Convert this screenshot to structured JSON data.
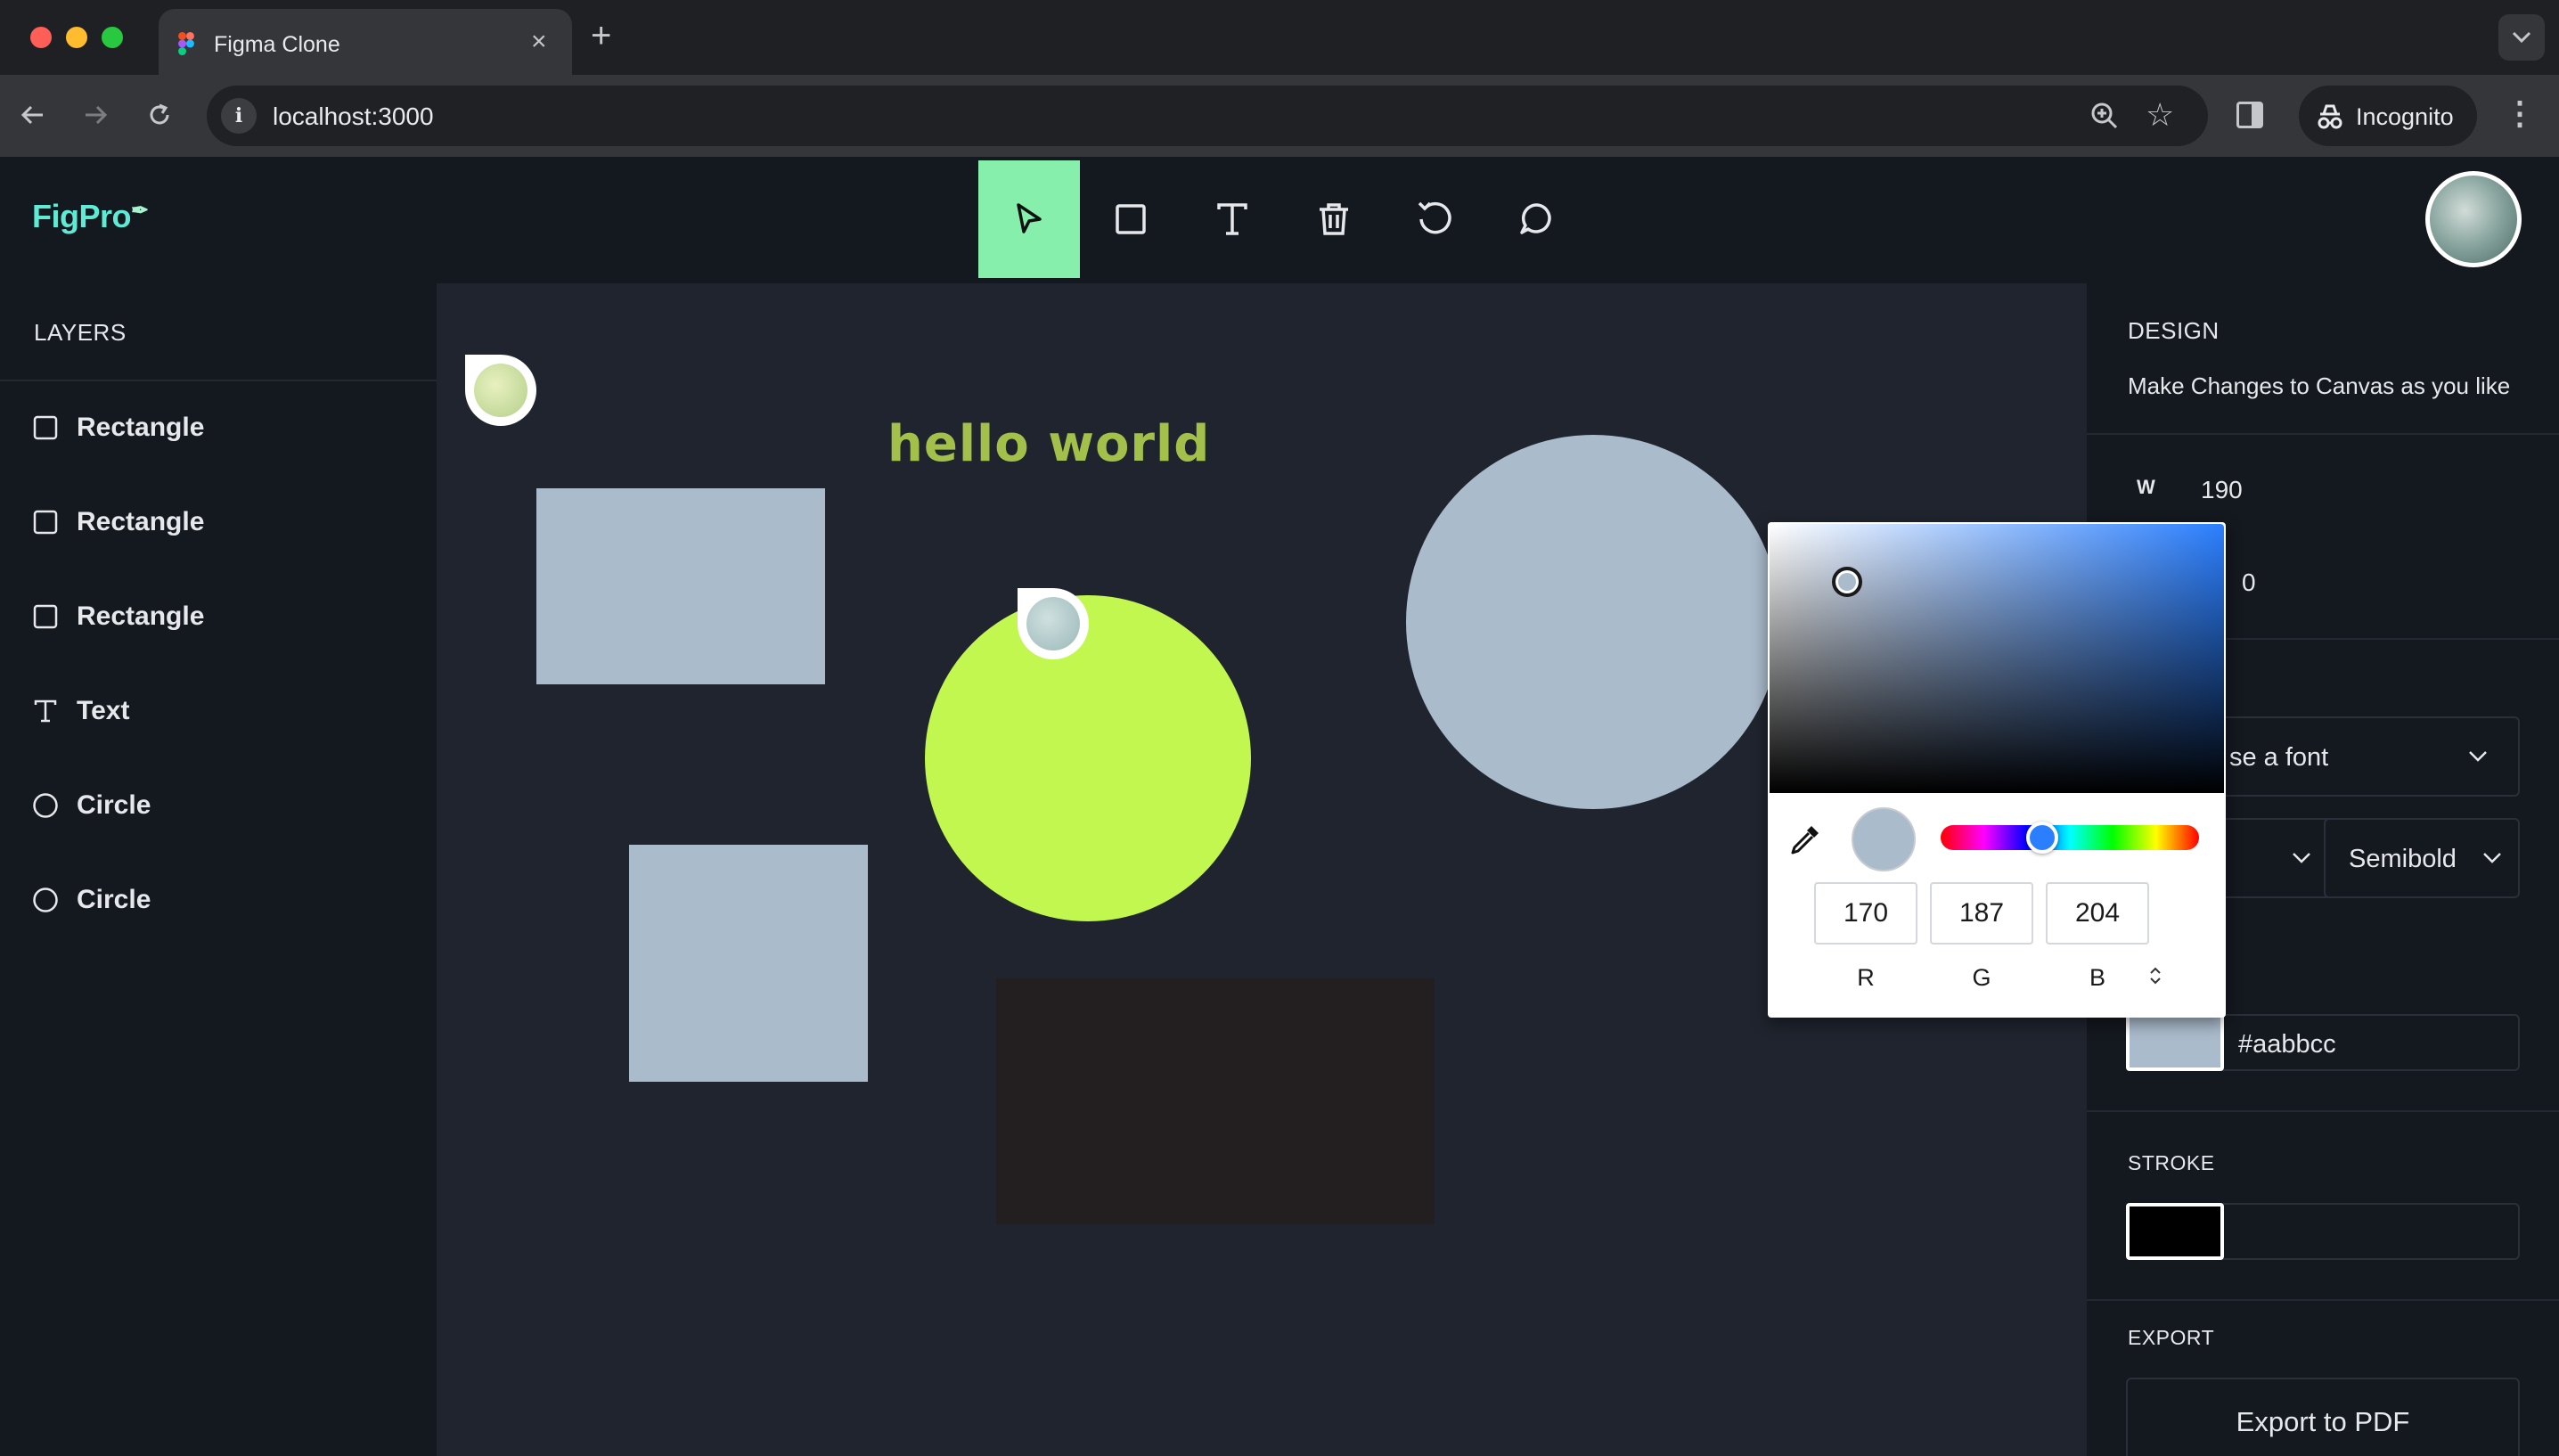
{
  "browser": {
    "tab_title": "Figma Clone",
    "tab_close": "×",
    "new_tab": "+",
    "tab_menu": "⌄",
    "url": "localhost:3000",
    "site_info": "i",
    "incognito_label": "Incognito",
    "kebab": "⋮",
    "nav_back": "←",
    "nav_forward": "→",
    "nav_reload": "↻",
    "star": "☆"
  },
  "app": {
    "logo": "FigPro",
    "logo_pen": "✒"
  },
  "layers": {
    "title": "LAYERS",
    "items": [
      {
        "label": "Rectangle",
        "icon": "square-icon"
      },
      {
        "label": "Rectangle",
        "icon": "square-icon"
      },
      {
        "label": "Rectangle",
        "icon": "square-icon"
      },
      {
        "label": "Text",
        "icon": "text-icon"
      },
      {
        "label": "Circle",
        "icon": "circle-icon"
      },
      {
        "label": "Circle",
        "icon": "circle-icon"
      }
    ]
  },
  "canvas": {
    "text_object": "hello world",
    "colors": {
      "rect": "#aabbcc",
      "circle_lime": "#c2f74f",
      "circle_gray": "#aabbcc",
      "dark_rect": "#231f20",
      "text": "#a3c04a"
    }
  },
  "design_panel": {
    "title": "DESIGN",
    "subtitle": "Make Changes to Canvas as you like",
    "w_label": "W",
    "w_value": "190",
    "h_value_partial": "0",
    "font_family_placeholder": "se a font",
    "font_weight": "Semibold",
    "fill_hex": "#aabbcc",
    "stroke_title": "STROKE",
    "export_title": "EXPORT",
    "export_button": "Export to PDF"
  },
  "color_picker": {
    "r": "170",
    "g": "187",
    "b": "204",
    "r_label": "R",
    "g_label": "G",
    "b_label": "B",
    "toggle": "⌃⌄"
  }
}
